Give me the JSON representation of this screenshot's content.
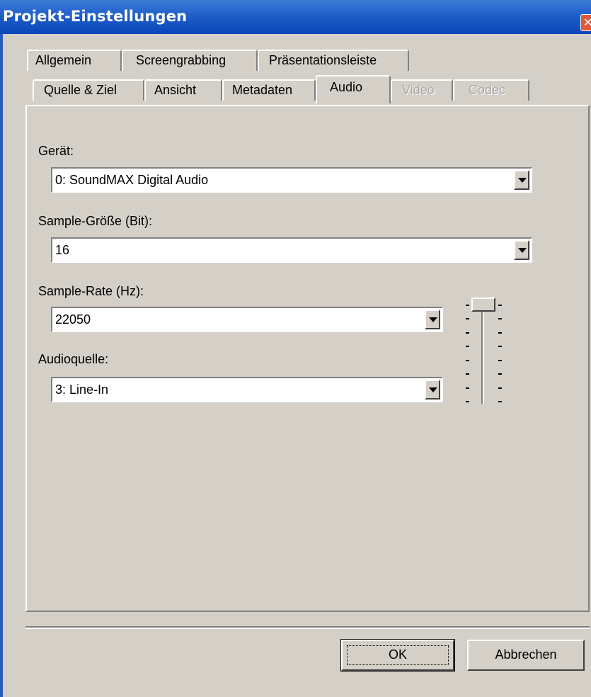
{
  "window": {
    "title": "Projekt-Einstellungen",
    "close_glyph": "✕"
  },
  "tabs_row1": [
    {
      "label": "Allgemein"
    },
    {
      "label": "Screengrabbing"
    },
    {
      "label": "Präsentationsleiste"
    }
  ],
  "tabs_row2": [
    {
      "label": "Quelle & Ziel",
      "enabled": true
    },
    {
      "label": "Ansicht",
      "enabled": true
    },
    {
      "label": "Metadaten",
      "enabled": true
    },
    {
      "label": "Audio",
      "enabled": true,
      "selected": true
    },
    {
      "label": "Video",
      "enabled": false
    },
    {
      "label": "Codec",
      "enabled": false
    }
  ],
  "form": {
    "device_label": "Gerät:",
    "device_value": "0: SoundMAX Digital Audio",
    "sample_size_label": "Sample-Größe (Bit):",
    "sample_size_value": "16",
    "sample_rate_label": "Sample-Rate (Hz):",
    "sample_rate_value": "22050",
    "audio_source_label": "Audioquelle:",
    "audio_source_value": "3: Line-In"
  },
  "volume_slider": {
    "level": 1.0,
    "tick_count": 8
  },
  "buttons": {
    "ok": "OK",
    "cancel": "Abbrechen"
  }
}
